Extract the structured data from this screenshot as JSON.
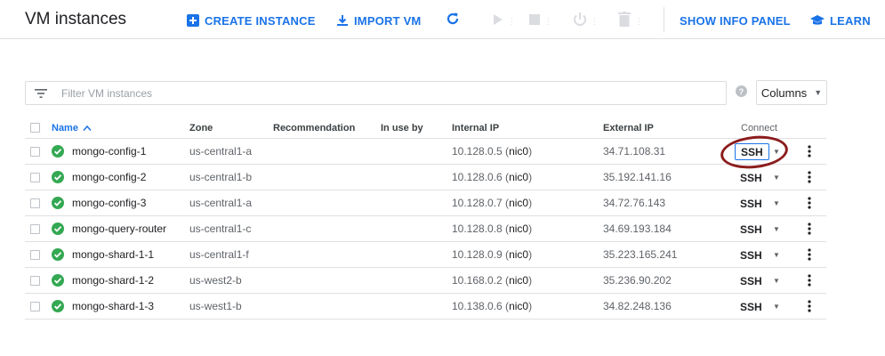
{
  "header": {
    "title": "VM instances",
    "create_label": "CREATE INSTANCE",
    "import_label": "IMPORT VM",
    "info_panel_label": "SHOW INFO PANEL",
    "learn_label": "LEARN"
  },
  "filter": {
    "placeholder": "Filter VM instances",
    "columns_label": "Columns"
  },
  "table": {
    "headers": {
      "name": "Name",
      "zone": "Zone",
      "recommendation": "Recommendation",
      "in_use_by": "In use by",
      "internal_ip": "Internal IP",
      "external_ip": "External IP",
      "connect": "Connect"
    },
    "ssh_label": "SSH",
    "rows": [
      {
        "name": "mongo-config-1",
        "zone": "us-central1-a",
        "ip": "10.128.0.5",
        "nic": "nic0",
        "external_ip": "34.71.108.31"
      },
      {
        "name": "mongo-config-2",
        "zone": "us-central1-b",
        "ip": "10.128.0.6",
        "nic": "nic0",
        "external_ip": "35.192.141.16"
      },
      {
        "name": "mongo-config-3",
        "zone": "us-central1-a",
        "ip": "10.128.0.7",
        "nic": "nic0",
        "external_ip": "34.72.76.143"
      },
      {
        "name": "mongo-query-router",
        "zone": "us-central1-c",
        "ip": "10.128.0.8",
        "nic": "nic0",
        "external_ip": "34.69.193.184"
      },
      {
        "name": "mongo-shard-1-1",
        "zone": "us-central1-f",
        "ip": "10.128.0.9",
        "nic": "nic0",
        "external_ip": "35.223.165.241"
      },
      {
        "name": "mongo-shard-1-2",
        "zone": "us-west2-b",
        "ip": "10.168.0.2",
        "nic": "nic0",
        "external_ip": "35.236.90.202"
      },
      {
        "name": "mongo-shard-1-3",
        "zone": "us-west1-b",
        "ip": "10.138.0.6",
        "nic": "nic0",
        "external_ip": "34.82.248.136"
      }
    ]
  },
  "colors": {
    "accent": "#1a73e8",
    "status_ok": "#34a853",
    "annotation": "#8b1c1c"
  },
  "icons": {
    "create": "add-box-icon",
    "import": "download-icon",
    "refresh": "refresh-icon",
    "start": "play-icon",
    "stop": "stop-icon",
    "reset": "power-icon",
    "delete": "trash-icon",
    "learn": "graduation-cap-icon",
    "status": "check-circle-icon"
  }
}
